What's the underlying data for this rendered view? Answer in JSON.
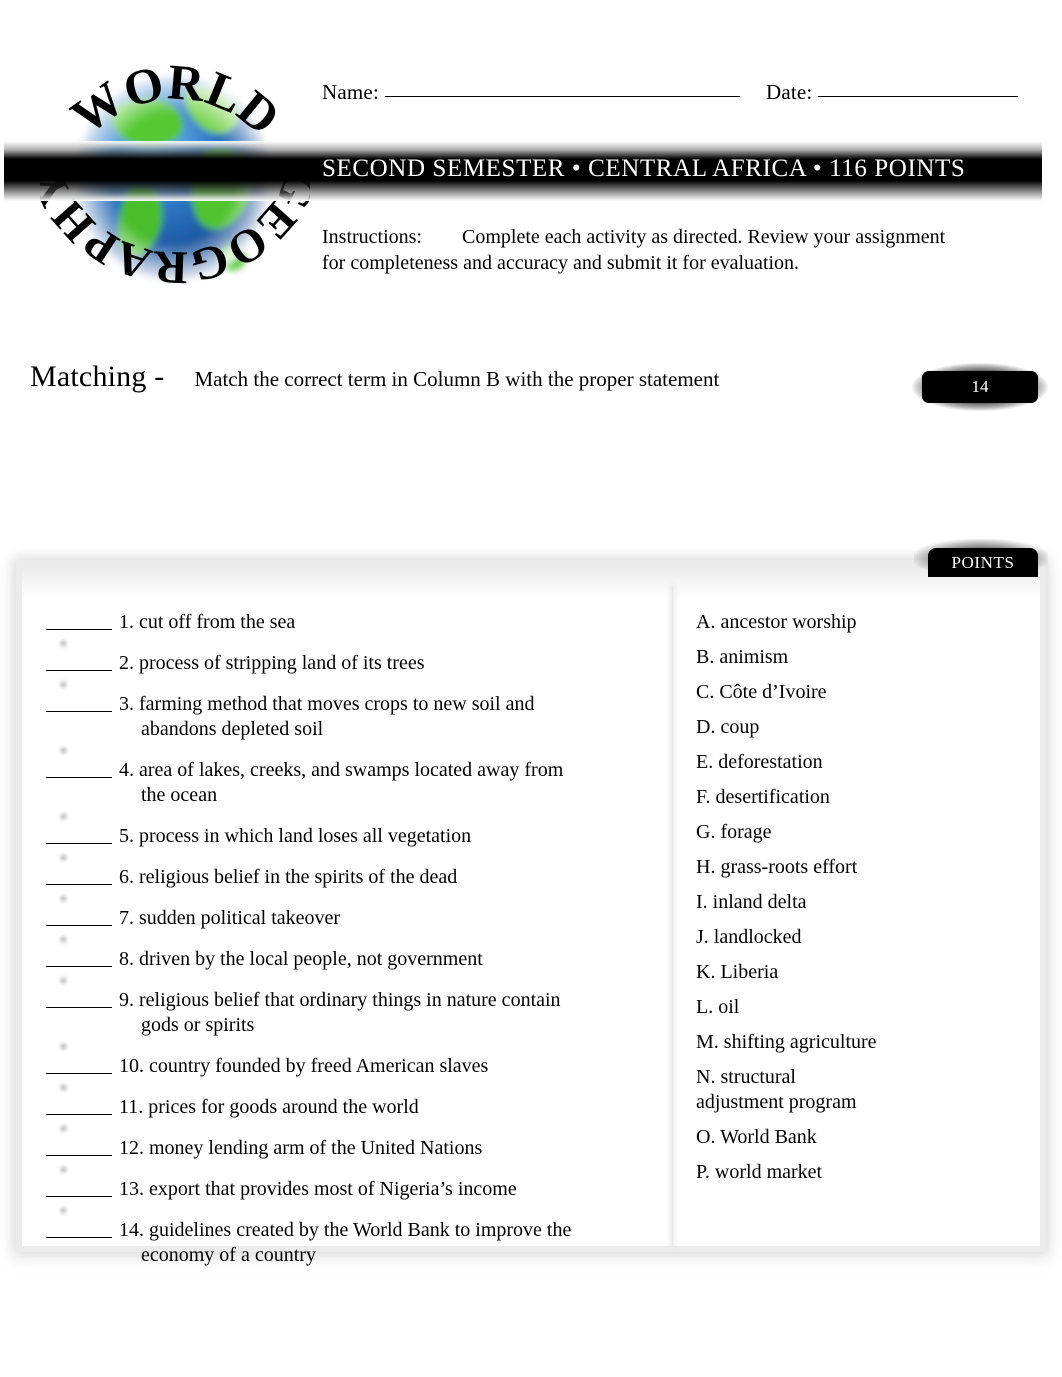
{
  "logo": {
    "top_arc_text": "WORLD",
    "bottom_arc_text": "GEOGRAPHY",
    "icon": "globe-icon",
    "colors": {
      "ocean": "#1b55a8",
      "land": "#3faf2a",
      "sky": "#4f8fd0"
    }
  },
  "header": {
    "name_label": "Name:",
    "date_label": "Date:",
    "banner_title": "SECOND SEMESTER  •  CENTRAL AFRICA  •  116 POINTS",
    "banner_color": "#000000",
    "instructions_label": "Instructions:",
    "instructions_text": "Complete each activity as directed. Review your assignment for completeness and accuracy and submit it for evaluation."
  },
  "section": {
    "title": "Matching -",
    "description": "Match the correct term in Column B with the proper statement",
    "points_value": "14",
    "points_tab_label": "POINTS"
  },
  "column_a": {
    "items": [
      {
        "number": "1.",
        "line1": "cut off from the sea",
        "line2": ""
      },
      {
        "number": "2.",
        "line1": "process of stripping land of its trees",
        "line2": ""
      },
      {
        "number": "3.",
        "line1": "farming method that moves crops to new soil and",
        "line2": "abandons depleted soil"
      },
      {
        "number": "4.",
        "line1": "area of lakes, creeks, and swamps located away from",
        "line2": "the ocean"
      },
      {
        "number": "5.",
        "line1": "process in which land loses all vegetation",
        "line2": ""
      },
      {
        "number": "6.",
        "line1": "religious belief in the spirits of the dead",
        "line2": ""
      },
      {
        "number": "7.",
        "line1": "sudden political takeover",
        "line2": ""
      },
      {
        "number": "8.",
        "line1": "driven by the local people, not government",
        "line2": ""
      },
      {
        "number": "9.",
        "line1": "religious belief that ordinary things in nature contain",
        "line2": "gods or spirits"
      },
      {
        "number": "10.",
        "line1": "country founded by freed American slaves",
        "line2": ""
      },
      {
        "number": "11.",
        "line1": "prices for goods around the world",
        "line2": ""
      },
      {
        "number": "12.",
        "line1": "money lending arm of the United Nations",
        "line2": ""
      },
      {
        "number": "13.",
        "line1": "export that provides most of Nigeria’s income",
        "line2": ""
      },
      {
        "number": "14.",
        "line1": "guidelines created by the World Bank to improve the",
        "line2": "economy of a country"
      }
    ]
  },
  "column_b": {
    "items": [
      {
        "letter": "A.",
        "term": "ancestor worship",
        "cont": ""
      },
      {
        "letter": "B.",
        "term": "animism",
        "cont": ""
      },
      {
        "letter": "C.",
        "term": "Côte d’Ivoire",
        "cont": ""
      },
      {
        "letter": "D.",
        "term": "coup",
        "cont": ""
      },
      {
        "letter": "E.",
        "term": "deforestation",
        "cont": ""
      },
      {
        "letter": "F.",
        "term": "desertification",
        "cont": ""
      },
      {
        "letter": "G.",
        "term": "forage",
        "cont": ""
      },
      {
        "letter": "H.",
        "term": "grass-roots effort",
        "cont": ""
      },
      {
        "letter": "I.",
        "term": "inland delta",
        "cont": ""
      },
      {
        "letter": "J.",
        "term": "landlocked",
        "cont": ""
      },
      {
        "letter": "K.",
        "term": "Liberia",
        "cont": ""
      },
      {
        "letter": "L.",
        "term": "oil",
        "cont": ""
      },
      {
        "letter": "M.",
        "term": "shifting agriculture",
        "cont": ""
      },
      {
        "letter": "N.",
        "term": "structural",
        "cont": "adjustment program"
      },
      {
        "letter": "O.",
        "term": "World Bank",
        "cont": ""
      },
      {
        "letter": "P.",
        "term": "world market",
        "cont": ""
      }
    ]
  }
}
